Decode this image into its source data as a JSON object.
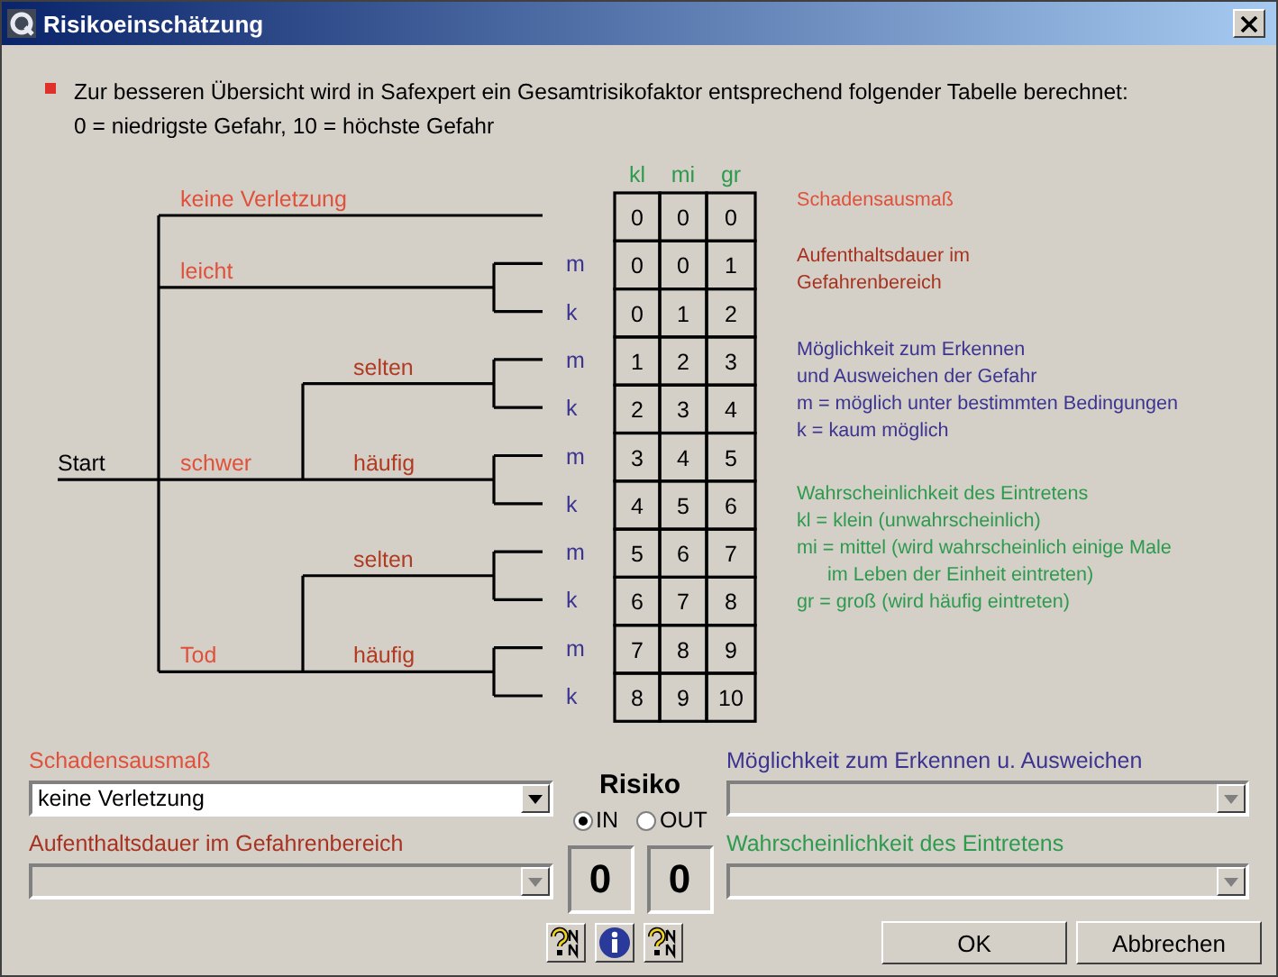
{
  "window": {
    "title": "Risikoeinschätzung"
  },
  "intro": {
    "lines": [
      "Zur besseren Übersicht wird in Safexpert ein Gesamtrisikofaktor entsprechend folgender Tabelle berechnet:",
      "0 = niedrigste Gefahr, 10 = höchste Gefahr"
    ]
  },
  "tree": {
    "root": "Start",
    "branches": [
      {
        "label": "keine Verletzung"
      },
      {
        "label": "leicht",
        "children": [
          {
            "label": "m"
          },
          {
            "label": "k"
          }
        ]
      },
      {
        "label": "schwer",
        "children": [
          {
            "label": "selten",
            "children": [
              {
                "label": "m"
              },
              {
                "label": "k"
              }
            ]
          },
          {
            "label": "häufig",
            "children": [
              {
                "label": "m"
              },
              {
                "label": "k"
              }
            ]
          }
        ]
      },
      {
        "label": "Tod",
        "children": [
          {
            "label": "selten",
            "children": [
              {
                "label": "m"
              },
              {
                "label": "k"
              }
            ]
          },
          {
            "label": "häufig",
            "children": [
              {
                "label": "m"
              },
              {
                "label": "k"
              }
            ]
          }
        ]
      }
    ]
  },
  "table": {
    "columns": [
      "kl",
      "mi",
      "gr"
    ],
    "rows": [
      [
        "0",
        "0",
        "0"
      ],
      [
        "0",
        "0",
        "1"
      ],
      [
        "0",
        "1",
        "2"
      ],
      [
        "1",
        "2",
        "3"
      ],
      [
        "2",
        "3",
        "4"
      ],
      [
        "3",
        "4",
        "5"
      ],
      [
        "4",
        "5",
        "6"
      ],
      [
        "5",
        "6",
        "7"
      ],
      [
        "6",
        "7",
        "8"
      ],
      [
        "7",
        "8",
        "9"
      ],
      [
        "8",
        "9",
        "10"
      ]
    ]
  },
  "legend": [
    {
      "color": "#e0503a",
      "lines": [
        {
          "text": "Schadensausmaß",
          "indent": false
        }
      ]
    },
    {
      "color": "#a83220",
      "lines": [
        {
          "text": "Aufenthaltsdauer im",
          "indent": false
        },
        {
          "text": "Gefahrenbereich",
          "indent": false
        }
      ]
    },
    {
      "color": "#3c3490",
      "lines": [
        {
          "text": "Möglichkeit zum Erkennen",
          "indent": false
        },
        {
          "text": "und Ausweichen der Gefahr",
          "indent": false
        },
        {
          "text": "m = möglich unter bestimmten Bedingungen",
          "indent": false
        },
        {
          "text": "k = kaum möglich",
          "indent": false
        }
      ]
    },
    {
      "color": "#2e9a4e",
      "lines": [
        {
          "text": "Wahrscheinlichkeit des Eintretens",
          "indent": false
        },
        {
          "text": "kl = klein (unwahrscheinlich)",
          "indent": false
        },
        {
          "text": "mi = mittel (wird wahrscheinlich einige Male",
          "indent": false
        },
        {
          "text": "im Leben der Einheit eintreten)",
          "indent": true
        },
        {
          "text": "gr = groß (wird häufig eintreten)",
          "indent": false
        }
      ]
    }
  ],
  "form": {
    "left": [
      {
        "label": "Schadensausmaß",
        "color": "#e0503a",
        "value": "keine Verletzung",
        "disabled": false
      },
      {
        "label": "Aufenthaltsdauer im Gefahrenbereich",
        "color": "#a83220",
        "disabled": true
      }
    ],
    "right": [
      {
        "label": "Möglichkeit zum Erkennen u. Ausweichen",
        "color": "#3c3490",
        "disabled": true
      },
      {
        "label": "Wahrscheinlichkeit des Eintretens",
        "color": "#2e9a4e",
        "disabled": true
      }
    ],
    "risk": {
      "title": "Risiko",
      "options": [
        {
          "label": "IN",
          "selected": true
        },
        {
          "label": "OUT",
          "selected": false
        }
      ],
      "values": [
        "0",
        "0"
      ]
    }
  },
  "tool_buttons": [
    {
      "kind": "help"
    },
    {
      "kind": "info"
    },
    {
      "kind": "help"
    }
  ],
  "buttons": [
    {
      "label": "OK"
    },
    {
      "label": "Abbrechen"
    }
  ]
}
